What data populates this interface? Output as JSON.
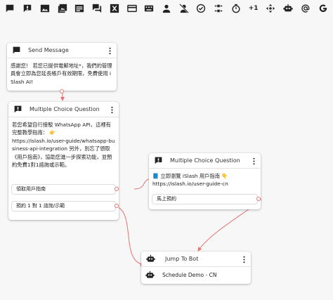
{
  "colors": {
    "canvas": "#f7f7f7",
    "card": "#ffffff",
    "edge": "#e57373",
    "icon": "#222222"
  },
  "toolbar": {
    "tools": [
      {
        "name": "chat-bubble-icon"
      },
      {
        "name": "quick-reply-icon"
      },
      {
        "name": "image-icon"
      },
      {
        "name": "media-icon"
      },
      {
        "name": "list-message-icon"
      },
      {
        "name": "multi-chat-icon"
      },
      {
        "name": "excel-icon"
      },
      {
        "name": "card-icon"
      },
      {
        "name": "keyboard-icon"
      },
      {
        "name": "person-icon"
      },
      {
        "name": "person-off-icon"
      },
      {
        "name": "check-circle-icon"
      },
      {
        "name": "condition-icon"
      },
      {
        "name": "timer-icon"
      },
      {
        "name": "plus-one-icon",
        "label": "+1"
      },
      {
        "name": "move-icon"
      },
      {
        "name": "robot-icon"
      },
      {
        "name": "at-icon"
      },
      {
        "name": "google-icon"
      }
    ]
  },
  "nodes": {
    "send_message": {
      "title": "Send Message",
      "text": "感謝您！ 若您已提供電郵地址*，我們的管理員會立即為您延長帳戶有效期限，免費使用 iSlash AI!"
    },
    "mcq1": {
      "title": "Multiple Choice Question",
      "text": "若您希望自行接駁 WhatsApp API，這裡有完整教學指南： 👉\nhttps://islash.io/user-guide/whatsapp-business-api-integration 另外，別忘了領取《用戶指南》，協助您進一步探索功能，並預約免費1對1諮詢或示範。",
      "choices": [
        "領取用戶指南",
        "預約 1 對 1 諮詢/示範"
      ]
    },
    "mcq2": {
      "title": "Multiple Choice Question",
      "text": "📘 立即瀏覽 iSlash 用戶指南 👇\nhttps://islash.io/user-guide-cn",
      "choices": [
        "馬上預約"
      ]
    },
    "jump": {
      "title": "Jump To Bot",
      "target": "Schedule Demo - CN"
    }
  }
}
